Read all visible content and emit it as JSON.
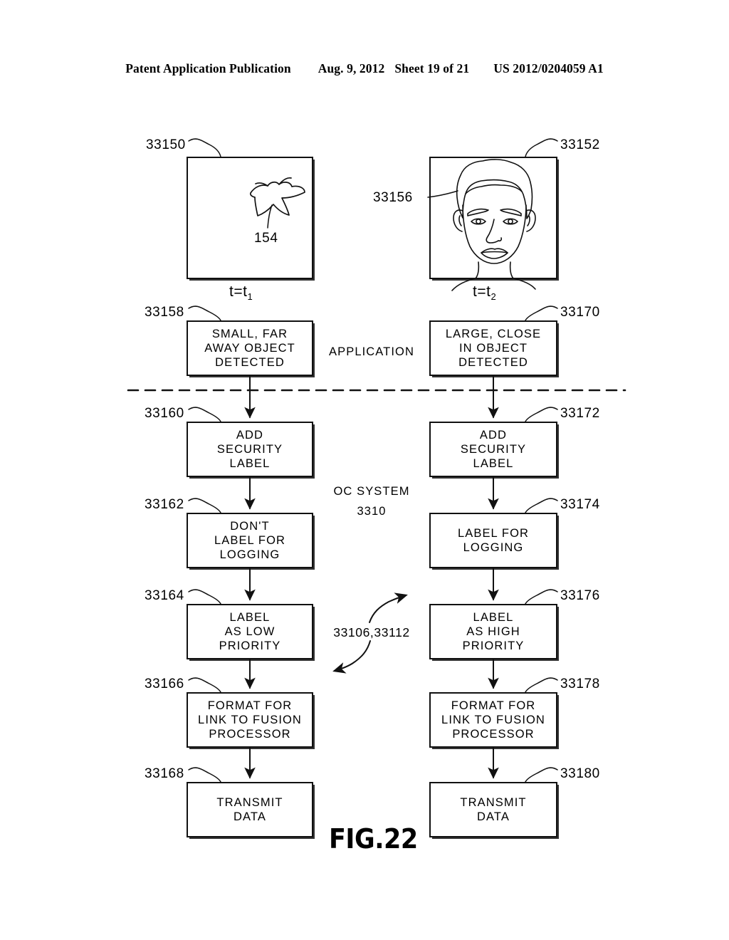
{
  "header": {
    "publication": "Patent Application Publication",
    "date": "Aug. 9, 2012",
    "sheet": "Sheet 19 of 21",
    "number": "US 2012/0204059 A1"
  },
  "figure": {
    "title": "FIG.22"
  },
  "panels": {
    "left": {
      "ref": "33150",
      "caption_prefix": "t=t",
      "caption_sub": "1",
      "object_icon": "bird-icon",
      "object_ref": "154"
    },
    "right": {
      "ref": "33152",
      "caption_prefix": "t=t",
      "caption_sub": "2",
      "object_icon": "face-icon",
      "object_ref": "33156"
    }
  },
  "center_labels": {
    "application": "APPLICATION",
    "oc_system": "OC SYSTEM\n3310",
    "cross_ref": "33106,33112"
  },
  "flow": {
    "left_column": [
      {
        "ref": "33158",
        "text": "SMALL, FAR\nAWAY OBJECT\nDETECTED"
      },
      {
        "ref": "33160",
        "text": "ADD\nSECURITY\nLABEL"
      },
      {
        "ref": "33162",
        "text": "DON'T\nLABEL FOR\nLOGGING"
      },
      {
        "ref": "33164",
        "text": "LABEL\nAS LOW\nPRIORITY"
      },
      {
        "ref": "33166",
        "text": "FORMAT FOR\nLINK TO FUSION\nPROCESSOR"
      },
      {
        "ref": "33168",
        "text": "TRANSMIT\nDATA"
      }
    ],
    "right_column": [
      {
        "ref": "33170",
        "text": "LARGE, CLOSE\nIN OBJECT\nDETECTED"
      },
      {
        "ref": "33172",
        "text": "ADD\nSECURITY\nLABEL"
      },
      {
        "ref": "33174",
        "text": "LABEL FOR\nLOGGING"
      },
      {
        "ref": "33176",
        "text": "LABEL\nAS HIGH\nPRIORITY"
      },
      {
        "ref": "33178",
        "text": "FORMAT FOR\nLINK TO FUSION\nPROCESSOR"
      },
      {
        "ref": "33180",
        "text": "TRANSMIT\nDATA"
      }
    ]
  }
}
